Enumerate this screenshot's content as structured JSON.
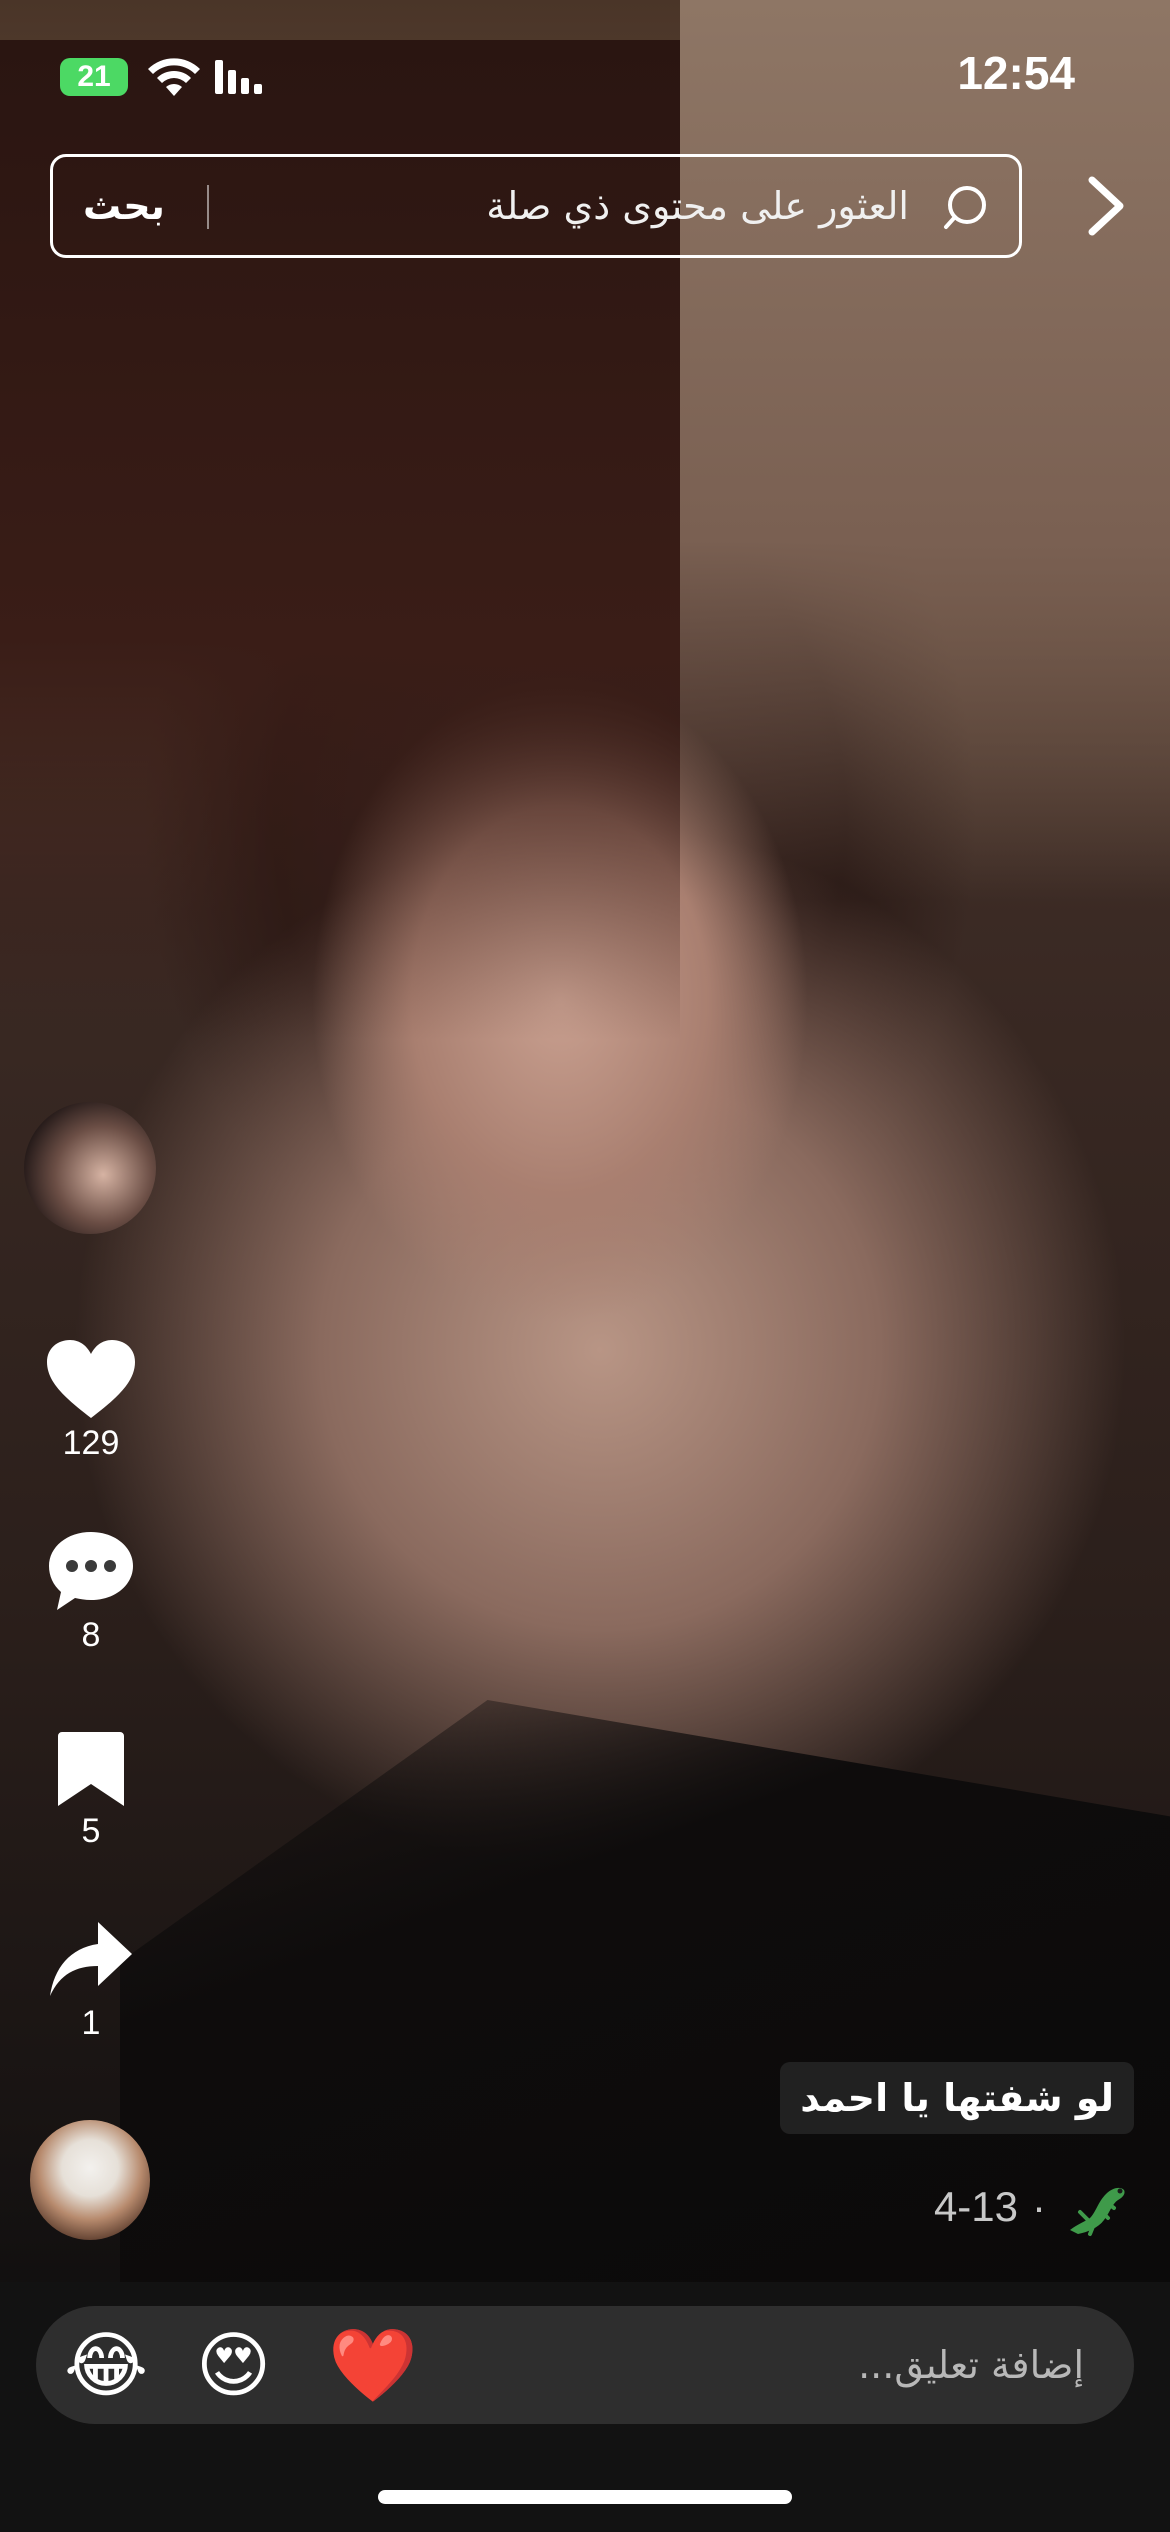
{
  "status_bar": {
    "battery": "21",
    "time": "12:54"
  },
  "search": {
    "button_label": "بحث",
    "placeholder": "العثور على محتوى ذي صلة"
  },
  "actions": {
    "likes": "129",
    "comments": "8",
    "saves": "5",
    "shares": "1"
  },
  "post": {
    "caption": "لو شفتها يا احمد",
    "date": "4-13",
    "separator": "·"
  },
  "comment_bar": {
    "placeholder": "إضافة تعليق...",
    "emojis": [
      "😂",
      "😍",
      "❤️"
    ]
  },
  "colors": {
    "battery": "#4cd964",
    "comment_bar": "#2e2e2e",
    "like": "#ffffff"
  },
  "icons": [
    "back-chevron-icon",
    "search-icon",
    "heart-icon",
    "comment-icon",
    "bookmark-icon",
    "share-icon",
    "wifi-icon",
    "signal-icon",
    "gecko-icon"
  ]
}
